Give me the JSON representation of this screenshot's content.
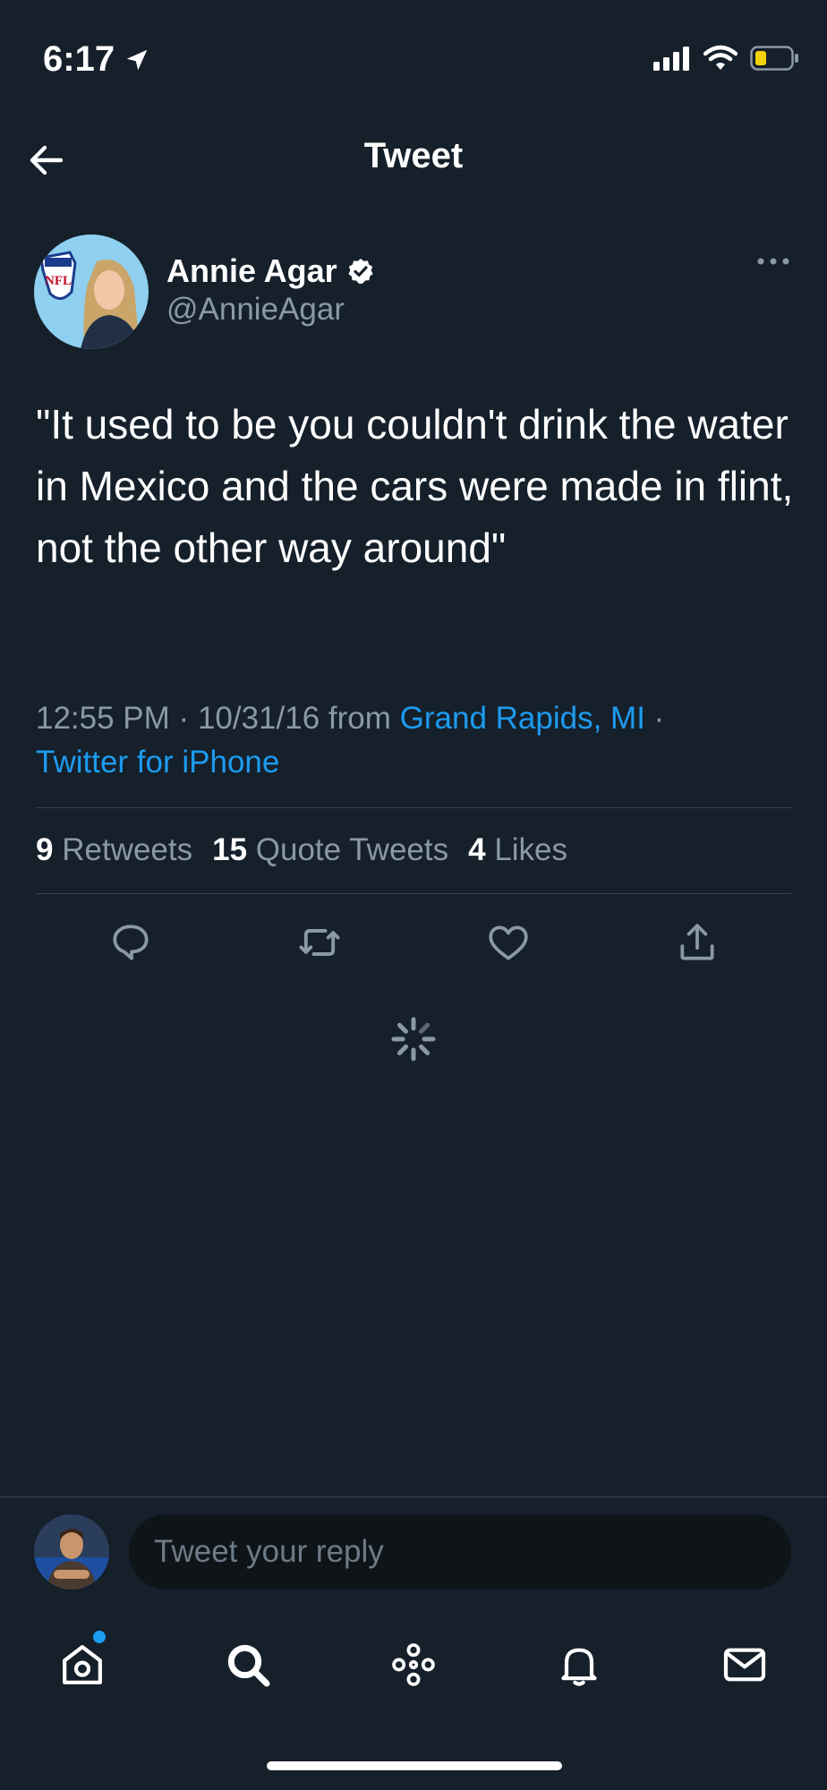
{
  "status_bar": {
    "time": "6:17"
  },
  "header": {
    "title": "Tweet"
  },
  "author": {
    "name": "Annie Agar",
    "handle": "@AnnieAgar",
    "avatar_badge": "NFL"
  },
  "tweet": {
    "text": "\"It used to be you couldn't drink the water in Mexico and the cars were made in flint, not the other way around\"",
    "time": "12:55 PM",
    "date": "10/31/16",
    "from": "from",
    "location": "Grand Rapids, MI",
    "source": "Twitter for iPhone"
  },
  "stats": {
    "retweets_count": "9",
    "retweets_label": "Retweets",
    "quotes_count": "15",
    "quotes_label": "Quote Tweets",
    "likes_count": "4",
    "likes_label": "Likes"
  },
  "reply": {
    "placeholder": "Tweet your reply"
  },
  "colors": {
    "background": "#15202b",
    "accent": "#1d9bf0",
    "muted": "#8b98a5",
    "divider": "#38444d"
  },
  "icons": {
    "back": "arrow-left-icon",
    "more": "more-icon",
    "reply": "reply-icon",
    "retweet": "retweet-icon",
    "like": "heart-icon",
    "share": "share-icon",
    "home": "home-icon",
    "search": "search-icon",
    "spaces": "spaces-icon",
    "notifications": "bell-icon",
    "messages": "mail-icon"
  }
}
